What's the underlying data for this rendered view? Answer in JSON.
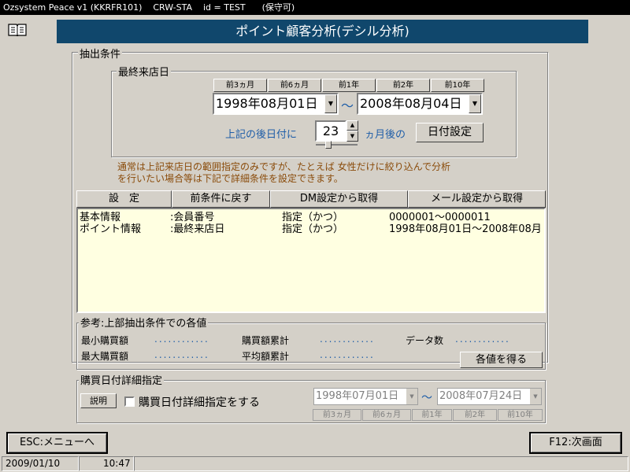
{
  "window": {
    "title": "Ozsystem Peace v1 (KKRFR101)    CRW-STA    id = TEST      (保守可)"
  },
  "header": {
    "title": "ポイント顧客分析(デシル分析)"
  },
  "extract": {
    "legend": "抽出条件",
    "last_visit": {
      "legend": "最終来店日",
      "presets": [
        "前3ヵ月",
        "前6ヵ月",
        "前1年",
        "前2年",
        "前10年"
      ],
      "from_date": "1998年08月01日",
      "tilde": "〜",
      "to_date": "2008年08月04日",
      "after_label": "上記の後日付に",
      "months_value": "23",
      "months_suffix": "ヵ月後の",
      "set_date_button": "日付設定"
    },
    "note": [
      "通常は上記来店日の範囲指定のみですが、たとえば 女性だけに絞り込んで分析",
      "を行いたい場合等は下記で詳細条件を設定できます。"
    ],
    "buttons": {
      "settings": "設　定",
      "restore": "前条件に戻す",
      "dm": "DM設定から取得",
      "mail": "メール設定から取得"
    },
    "conditions": [
      {
        "category": "基本情報",
        "field": ":会員番号",
        "mode": "指定（かつ）",
        "value": "0000001〜0000011"
      },
      {
        "category": "ポイント情報",
        "field": ":最終来店日",
        "mode": "指定（かつ）",
        "value": "1998年08月01日〜2008年08月"
      }
    ]
  },
  "reference": {
    "legend": "参考:上部抽出条件での各値",
    "min_purchase": "最小購買額",
    "total_purchase": "購買額累計",
    "data_count": "データ数",
    "max_purchase": "最大購買額",
    "avg_purchase": "平均額累計",
    "dots": "............",
    "get_values_button": "各値を得る"
  },
  "purchase_date": {
    "legend": "購買日付詳細指定",
    "help_button": "説明",
    "checkbox_label": "購買日付詳細指定をする",
    "checked": false,
    "from_date": "1998年07月01日",
    "tilde": "〜",
    "to_date": "2008年07月24日",
    "presets": [
      "前3ヵ月",
      "前6ヵ月",
      "前1年",
      "前2年",
      "前10年"
    ]
  },
  "footer": {
    "esc_button": "ESC:メニューへ",
    "next_button": "F12:次画面"
  },
  "status": {
    "date": "2009/01/10",
    "time": "10:47"
  }
}
